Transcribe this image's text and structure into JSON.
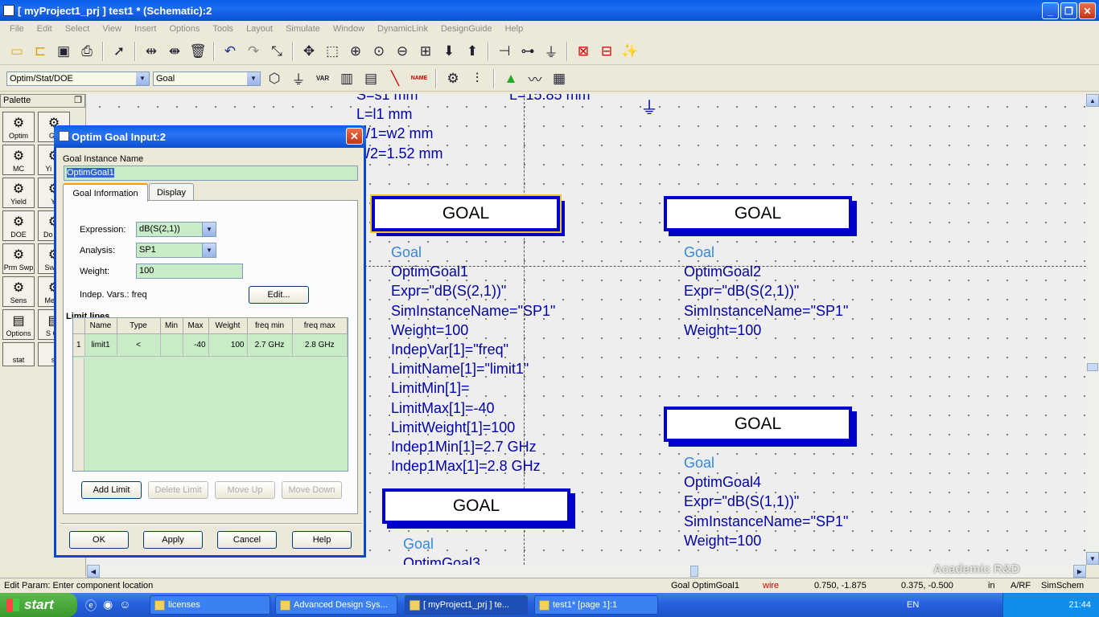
{
  "window": {
    "title": "[ myProject1_prj ] test1 * (Schematic):2"
  },
  "menu": [
    "File",
    "Edit",
    "Select",
    "View",
    "Insert",
    "Options",
    "Tools",
    "Layout",
    "Simulate",
    "Window",
    "DynamicLink",
    "DesignGuide",
    "Help"
  ],
  "toolbar2": {
    "library_combo": "Optim/Stat/DOE",
    "component_combo": "Goal",
    "var_label": "VAR",
    "name_label": "NAME"
  },
  "palette": {
    "title": "Palette",
    "items": [
      "Optim",
      "Go",
      "MC",
      "Yi Sp",
      "Yield",
      "Yi",
      "DOE",
      "Do Go",
      "Prm Swp",
      "Sw Pl",
      "Sens",
      "Me Ei",
      "Options",
      "S Co",
      "stat",
      "sl"
    ]
  },
  "canvas": {
    "top_text": [
      "S=s1 mm",
      "L=l1 mm",
      "W1=w2 mm",
      "W2=1.52 mm"
    ],
    "top_right_partial": "L=15.85 mm",
    "goal_box_label": "GOAL",
    "goal1": [
      "Goal",
      "OptimGoal1",
      "Expr=\"dB(S(2,1))\"",
      "SimInstanceName=\"SP1\"",
      "Weight=100",
      "IndepVar[1]=\"freq\"",
      "LimitName[1]=\"limit1\"",
      "LimitMin[1]=",
      "LimitMax[1]=-40",
      "LimitWeight[1]=100",
      "Indep1Min[1]=2.7 GHz",
      "Indep1Max[1]=2.8 GHz"
    ],
    "goal2": [
      "Goal",
      "OptimGoal2",
      "Expr=\"dB(S(2,1))\"",
      "SimInstanceName=\"SP1\"",
      "Weight=100"
    ],
    "goal3": [
      "Goal",
      "OptimGoal3"
    ],
    "goal4": [
      "Goal",
      "OptimGoal4",
      "Expr=\"dB(S(1,1))\"",
      "SimInstanceName=\"SP1\"",
      "Weight=100"
    ]
  },
  "dialog": {
    "title": "Optim Goal Input:2",
    "instance_label": "Goal Instance Name",
    "instance_value": "OptimGoal1",
    "tabs": [
      "Goal Information",
      "Display"
    ],
    "expression_label": "Expression:",
    "expression_value": "dB(S(2,1))",
    "analysis_label": "Analysis:",
    "analysis_value": "SP1",
    "weight_label": "Weight:",
    "weight_value": "100",
    "indep_label": "Indep. Vars.: freq",
    "edit_btn": "Edit...",
    "limit_lines_label": "Limit lines",
    "grid_headers": [
      "Name",
      "Type",
      "Min",
      "Max",
      "Weight",
      "freq min",
      "freq max"
    ],
    "grid_rows": [
      [
        "1",
        "limit1",
        "<",
        "",
        "-40",
        "100",
        "2.7 GHz",
        "2.8 GHz"
      ]
    ],
    "add_limit": "Add Limit",
    "delete_limit": "Delete Limit",
    "move_up": "Move Up",
    "move_down": "Move Down",
    "ok": "OK",
    "apply": "Apply",
    "cancel": "Cancel",
    "help": "Help"
  },
  "status": {
    "left": "Edit Param: Enter component location",
    "goal": "Goal OptimGoal1",
    "wire": "wire",
    "coord1": "0.750, -1.875",
    "coord2": "0.375, -0.500",
    "unit": "in",
    "mode": "A/RF",
    "schem": "SimSchem"
  },
  "taskbar": {
    "start": "start",
    "tasks": [
      "licenses",
      "Advanced Design Sys...",
      "[ myProject1_prj ] te...",
      "test1* [page 1]:1"
    ],
    "lang": "EN",
    "time": "21:44"
  },
  "watermark": "Academic R&D"
}
